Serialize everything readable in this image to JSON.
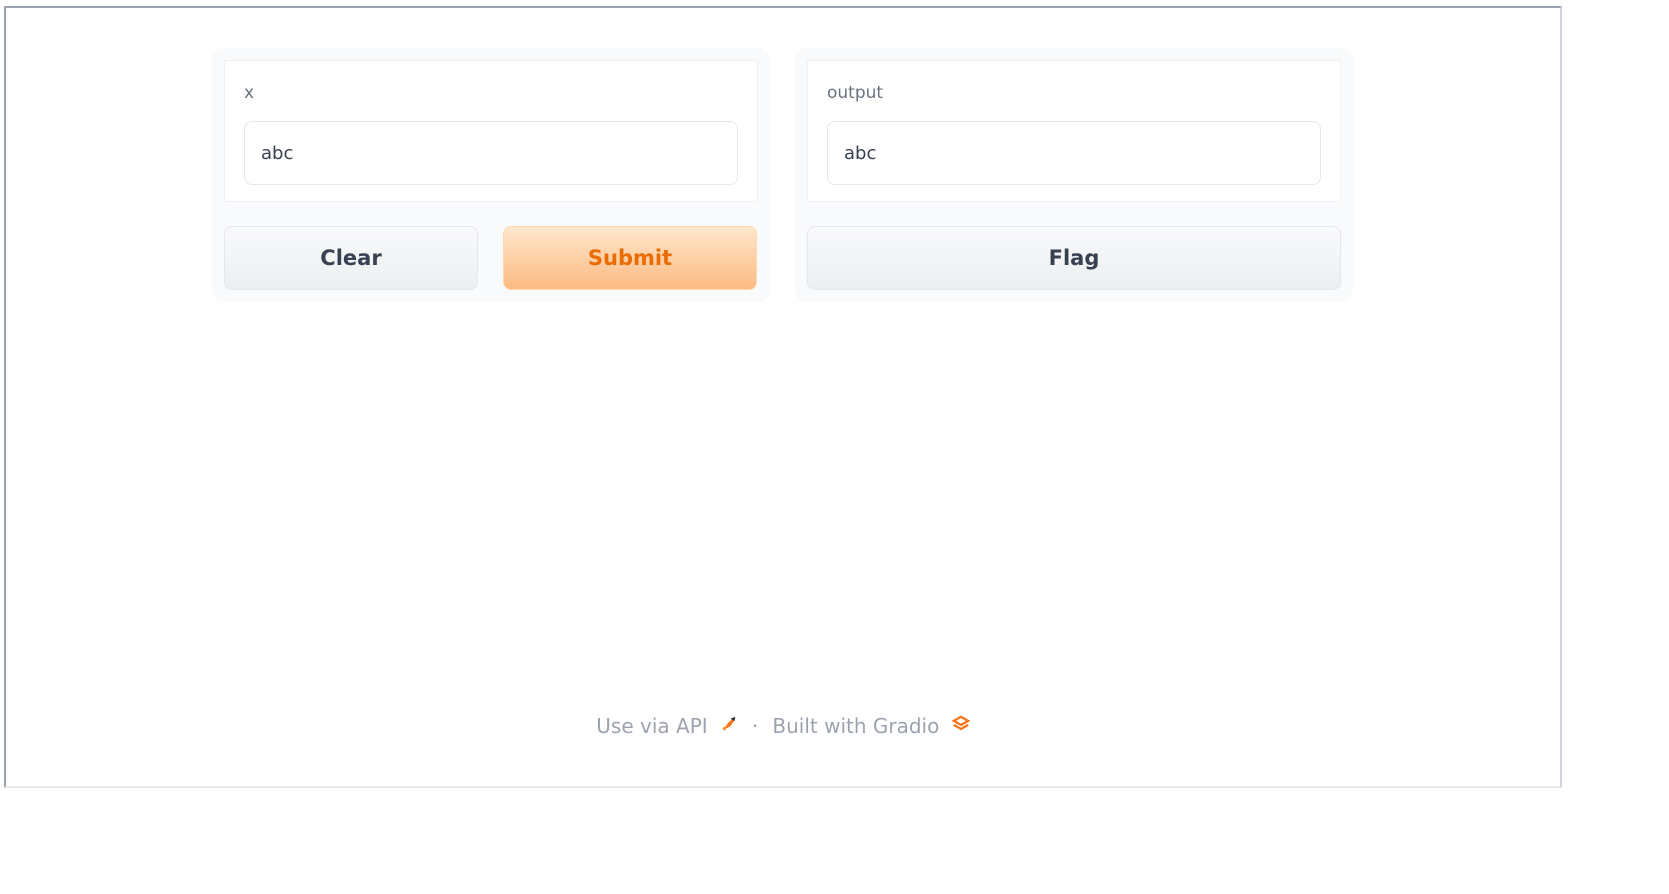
{
  "input": {
    "label": "x",
    "value": "abc"
  },
  "output": {
    "label": "output",
    "value": "abc"
  },
  "buttons": {
    "clear": "Clear",
    "submit": "Submit",
    "flag": "Flag"
  },
  "footer": {
    "api_link": "Use via API",
    "separator": "·",
    "built_with": "Built with Gradio"
  },
  "colors": {
    "accent": "#ea6c00",
    "primary_bg_top": "#fee7cc",
    "primary_bg_bottom": "#fdba82",
    "text_muted": "#9ca3af"
  }
}
